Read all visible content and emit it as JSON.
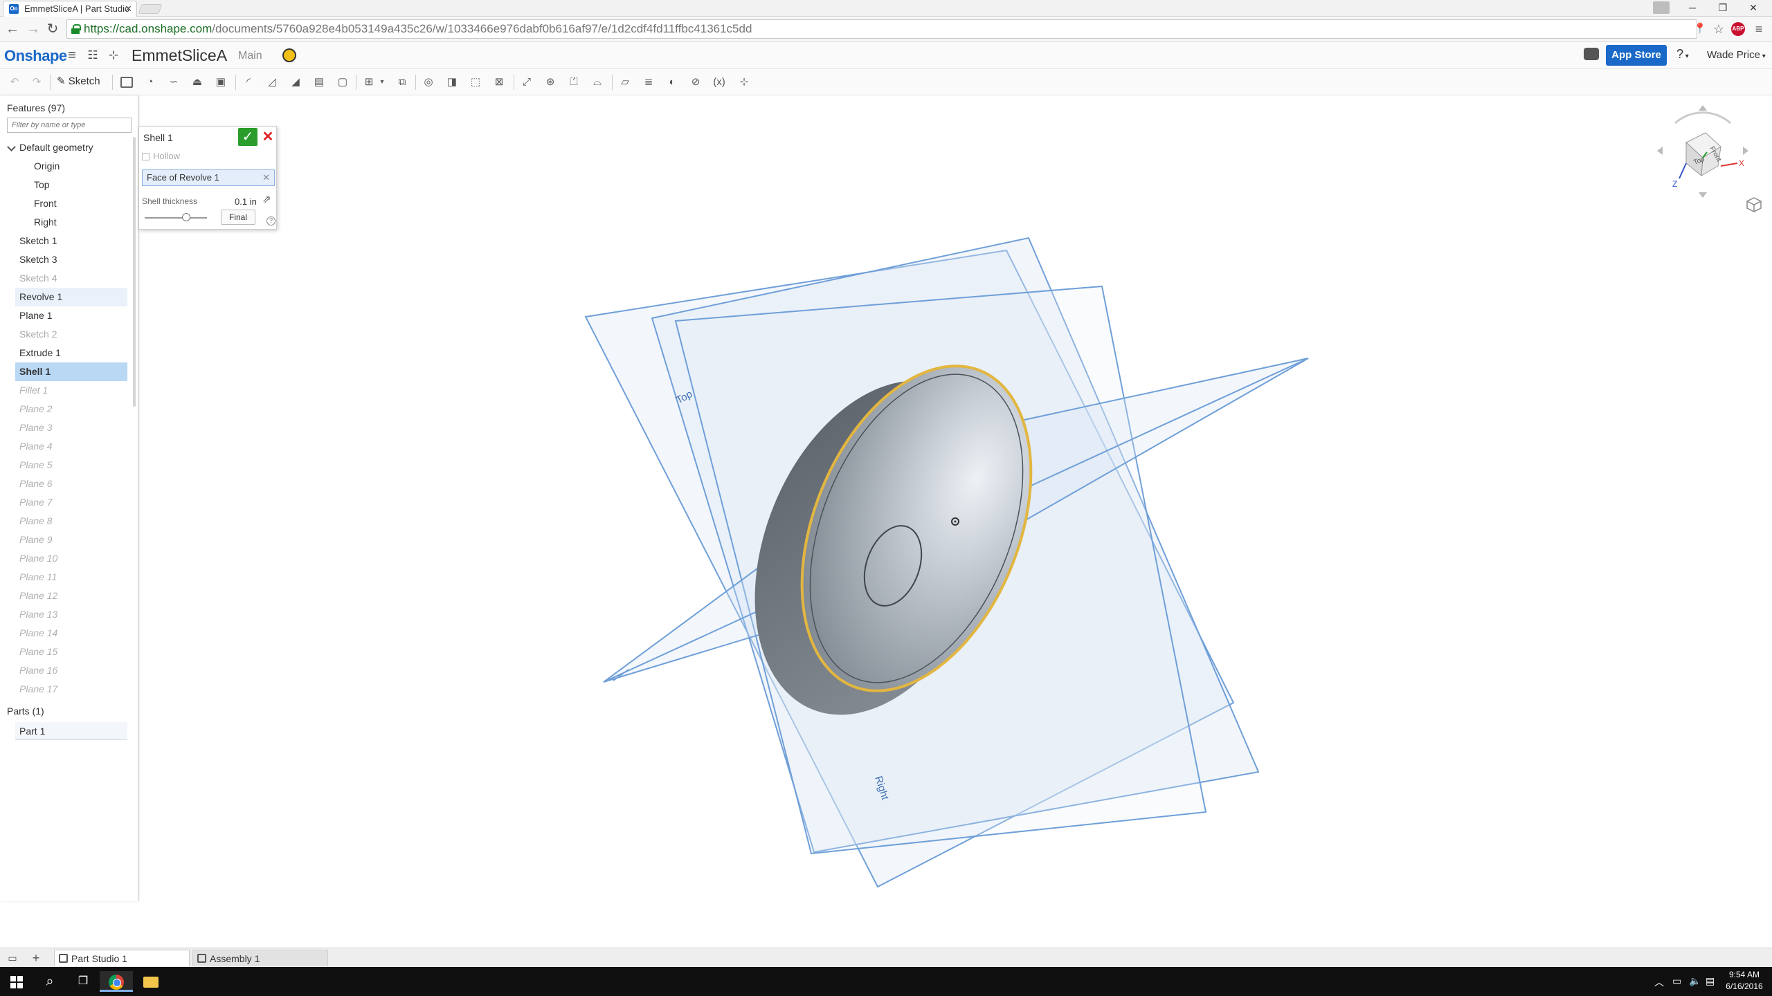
{
  "browser": {
    "tab_title": "EmmetSliceA | Part Studio",
    "tab_favicon": "On",
    "url_scheme": "https://",
    "url_host": "cad.onshape.com",
    "url_path": "/documents/5760a928e4b053149a435c26/w/1033466e976dabf0b616af97/e/1d2cdf4fd11ffbc41361c5dd",
    "abp_label": "ABP"
  },
  "header": {
    "logo": "Onshape",
    "document_title": "EmmetSliceA",
    "branch": "Main",
    "app_store": "App Store",
    "help": "?",
    "user": "Wade Price"
  },
  "toolbar": {
    "sketch_label": "Sketch",
    "variable_label": "(x)"
  },
  "features": {
    "heading": "Features (97)",
    "filter_placeholder": "Filter by name or type",
    "items": [
      {
        "label": "Default geometry",
        "kind": "group"
      },
      {
        "label": "Origin",
        "kind": "indent"
      },
      {
        "label": "Top",
        "kind": "indent"
      },
      {
        "label": "Front",
        "kind": "indent"
      },
      {
        "label": "Right",
        "kind": "indent"
      },
      {
        "label": "Sketch 1",
        "kind": "normal"
      },
      {
        "label": "Sketch 3",
        "kind": "normal"
      },
      {
        "label": "Sketch 4",
        "kind": "suppressed"
      },
      {
        "label": "Revolve 1",
        "kind": "highlight"
      },
      {
        "label": "Plane 1",
        "kind": "normal"
      },
      {
        "label": "Sketch 2",
        "kind": "suppressed"
      },
      {
        "label": "Extrude 1",
        "kind": "normal"
      },
      {
        "label": "Shell 1",
        "kind": "selected"
      },
      {
        "label": "Fillet 1",
        "kind": "rolled"
      },
      {
        "label": "Plane 2",
        "kind": "rolled"
      },
      {
        "label": "Plane 3",
        "kind": "rolled"
      },
      {
        "label": "Plane 4",
        "kind": "rolled"
      },
      {
        "label": "Plane 5",
        "kind": "rolled"
      },
      {
        "label": "Plane 6",
        "kind": "rolled"
      },
      {
        "label": "Plane 7",
        "kind": "rolled"
      },
      {
        "label": "Plane 8",
        "kind": "rolled"
      },
      {
        "label": "Plane 9",
        "kind": "rolled"
      },
      {
        "label": "Plane 10",
        "kind": "rolled"
      },
      {
        "label": "Plane 11",
        "kind": "rolled"
      },
      {
        "label": "Plane 12",
        "kind": "rolled"
      },
      {
        "label": "Plane 13",
        "kind": "rolled"
      },
      {
        "label": "Plane 14",
        "kind": "rolled"
      },
      {
        "label": "Plane 15",
        "kind": "rolled"
      },
      {
        "label": "Plane 16",
        "kind": "rolled"
      },
      {
        "label": "Plane 17",
        "kind": "rolled"
      }
    ]
  },
  "parts": {
    "heading": "Parts (1)",
    "items": [
      "Part 1"
    ]
  },
  "shell_dialog": {
    "title": "Shell 1",
    "hollow_label": "Hollow",
    "faces_value": "Face of Revolve 1",
    "thickness_label": "Shell thickness",
    "thickness_value": "0.1 in",
    "final_label": "Final"
  },
  "viewport": {
    "plane_labels": [
      "Top",
      "Right"
    ],
    "cube_faces": [
      "Top",
      "Front"
    ],
    "axis_labels": [
      "X",
      "Z"
    ]
  },
  "bottom_tabs": [
    {
      "label": "Part Studio 1",
      "active": true
    },
    {
      "label": "Assembly 1",
      "active": false
    }
  ],
  "taskbar": {
    "time": "9:54 AM",
    "date": "6/16/2016"
  },
  "colors": {
    "accent": "#1a69c8",
    "selected_row": "#b8d8f4",
    "plane_edge": "#6f9fd8",
    "part_edge": "#e2b640"
  }
}
